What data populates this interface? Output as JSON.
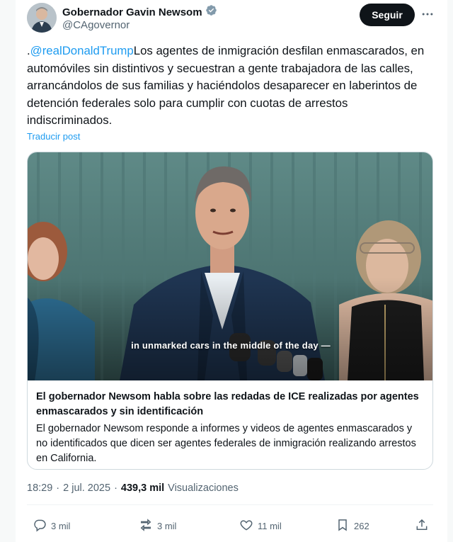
{
  "author": {
    "display_name": "Gobernador Gavin Newsom",
    "handle": "@CAgovernor",
    "verified_badge_icon": "verified-badge-icon",
    "verified_color": "#829aab"
  },
  "header": {
    "follow_label": "Seguir",
    "more_icon": "more-icon"
  },
  "tweet": {
    "prefix": ".",
    "mention": "@realDonaldTrump",
    "body": "Los agentes de inmigración desfilan enmascarados, en automóviles sin distintivos y secuestran a gente trabajadora de las calles, arrancándolos de sus familias y haciéndolos desaparecer en laberintos de detención federales solo para cumplir con cuotas de arrestos indiscriminados.",
    "translate_label": "Traducir post"
  },
  "media": {
    "caption": "in unmarked cars in the middle of the day —",
    "link_title": "El gobernador Newsom habla sobre las redadas de ICE realizadas por agentes enmascarados y sin identificación",
    "link_description": "El gobernador Newsom responde a informes y videos de agentes enmascarados y no identificados que dicen ser agentes federales de inmigración realizando arrestos en California."
  },
  "meta": {
    "time": "18:29",
    "separator": "·",
    "date": "2 jul. 2025",
    "views_count": "439,3 mil",
    "views_label": "Visualizaciones"
  },
  "actions": {
    "replies": "3 mil",
    "reposts": "3 mil",
    "likes": "11 mil",
    "bookmarks": "262"
  },
  "colors": {
    "link": "#1d9bf0",
    "text": "#0f1419",
    "muted": "#536471"
  }
}
